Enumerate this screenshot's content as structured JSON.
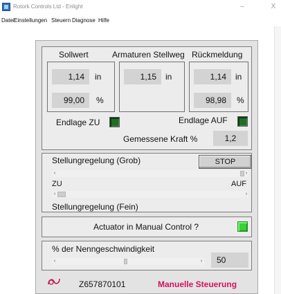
{
  "window": {
    "title": "Rotork Controls Ltd - Enlight",
    "minimize": "–",
    "close": "X"
  },
  "menu": [
    "Datei",
    "Einstellungen",
    "Steuern",
    "Diagnose",
    "Hilfe"
  ],
  "values_section": {
    "headers": {
      "sollwert": "Sollwert",
      "stellweg": "Armaturen Stellweg",
      "rueckmeldung": "Rückmeldung"
    },
    "sollwert": {
      "value_in": "1,14",
      "unit_in": "in",
      "value_pct": "99,00",
      "unit_pct": "%"
    },
    "stellweg": {
      "value_in": "1,15",
      "unit_in": "in"
    },
    "rueckmeldung": {
      "value_in": "1,14",
      "unit_in": "in",
      "value_pct": "98,98",
      "unit_pct": "%"
    },
    "endlage_zu_label": "Endlage ZU",
    "endlage_auf_label": "Endlage AUF",
    "kraft_label": "Gemessene Kraft %",
    "kraft_value": "1,2"
  },
  "regulation": {
    "grob_label": "Stellungregelung (Grob)",
    "stop_label": "STOP",
    "zu_label": "ZU",
    "auf_label": "AUF",
    "fein_label": "Stellungregelung (Fein)"
  },
  "manual": {
    "label": "Actuator in Manual Control ?"
  },
  "speed": {
    "label": "% der Nenngeschwindigkeit",
    "value": "50"
  },
  "footer": {
    "serial": "Z657870101",
    "mode": "Manuelle Steuerung"
  },
  "colors": {
    "led_off": "#1f6e26",
    "led_on": "#37d233",
    "mode_text": "#d3125f"
  }
}
